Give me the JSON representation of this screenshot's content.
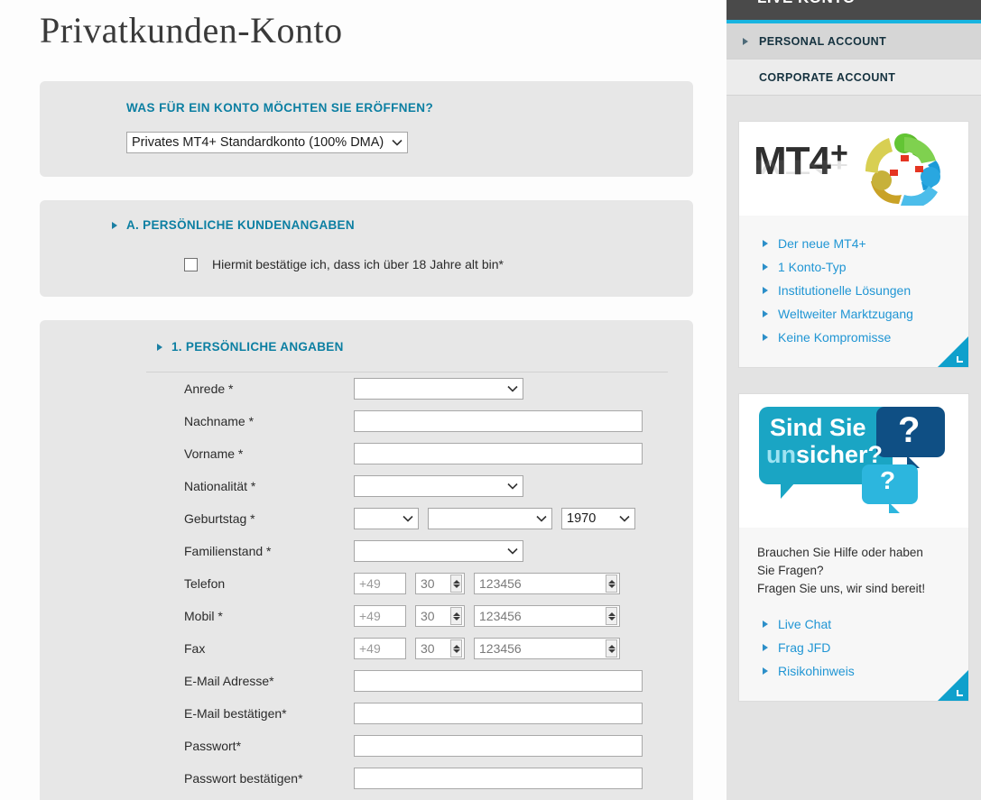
{
  "page": {
    "title": "Privatkunden-Konto"
  },
  "account_panel": {
    "legend": "WAS FÜR EIN KONTO MÖCHTEN SIE ERÖFFNEN?",
    "selected": "Privates MT4+ Standardkonto (100% DMA)",
    "caret_icon": "chevron-down-icon"
  },
  "section_a": {
    "arrow_icon": "triangle-right-icon",
    "heading": "A. PERSÖNLICHE KUNDENANGABEN",
    "checkbox_label": "Hiermit bestätige ich, dass ich über 18 Jahre alt bin*",
    "checkbox_checked": false
  },
  "section_1": {
    "arrow_icon": "triangle-right-icon",
    "heading": "1. PERSÖNLICHE ANGABEN",
    "fields": [
      {
        "label": "Anrede *",
        "type": "select",
        "value": ""
      },
      {
        "label": "Nachname *",
        "type": "text",
        "value": "",
        "placeholder": ""
      },
      {
        "label": "Vorname *",
        "type": "text",
        "value": "",
        "placeholder": ""
      },
      {
        "label": "Nationalität *",
        "type": "select",
        "value": ""
      },
      {
        "label": "Geburtstag *",
        "type": "date",
        "day": "",
        "month": "",
        "year": "1970"
      },
      {
        "label": "Familienstand *",
        "type": "select",
        "value": ""
      },
      {
        "label": "Telefon",
        "type": "phone",
        "country": "+49",
        "area": "30",
        "number": "123456"
      },
      {
        "label": "Mobil *",
        "type": "phone",
        "country": "+49",
        "area": "30",
        "number": "123456"
      },
      {
        "label": "Fax",
        "type": "phone",
        "country": "+49",
        "area": "30",
        "number": "123456"
      },
      {
        "label": "E-Mail Adresse*",
        "type": "text",
        "value": "",
        "placeholder": ""
      },
      {
        "label": "E-Mail bestätigen*",
        "type": "text",
        "value": "",
        "placeholder": ""
      },
      {
        "label": "Passwort*",
        "type": "text",
        "value": "",
        "placeholder": ""
      },
      {
        "label": "Passwort bestätigen*",
        "type": "text",
        "value": "",
        "placeholder": ""
      }
    ]
  },
  "sidebar": {
    "header_title": "LIVE KONTO",
    "accent_color": "#18b4e0",
    "tabs": [
      {
        "label": "PERSONAL ACCOUNT",
        "active": true,
        "arrow_icon": "triangle-right-icon"
      },
      {
        "label": "CORPORATE ACCOUNT",
        "active": false,
        "arrow_icon": ""
      }
    ],
    "mt4_card": {
      "logo_text": "MT4",
      "logo_plus": "+",
      "logo_icon": "metatrader-logo-icon",
      "links": [
        "Der neue MT4+",
        "1 Konto-Typ",
        "Institutionelle Lösungen",
        "Weltweiter Marktzugang",
        "Keine Kompromisse"
      ],
      "corner_icon": "resize-corner-icon"
    },
    "help_card": {
      "banner_line1": "Sind Sie",
      "banner_line2_accent": "un",
      "banner_line2_rest": "sicher?",
      "banner_icon": "speech-bubbles-icon",
      "question_marks": [
        "?",
        "?"
      ],
      "text_line1": "Brauchen Sie Hilfe oder haben",
      "text_line2": "Sie Fragen?",
      "text_line3": "Fragen Sie uns, wir sind bereit!",
      "links": [
        "Live Chat",
        "Frag JFD",
        "Risikohinweis"
      ],
      "corner_icon": "resize-corner-icon"
    }
  },
  "colors": {
    "teal_heading": "#0c7fa2",
    "link_blue": "#2196d4",
    "panel_bg": "#e7e7e7",
    "sidebar_bg": "#e3e3e3",
    "accent": "#18b4e0"
  }
}
